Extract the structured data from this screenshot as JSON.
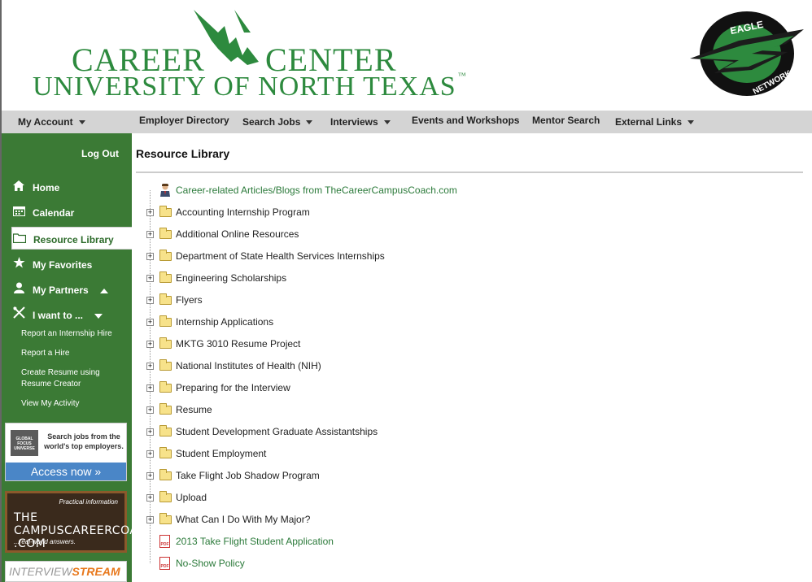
{
  "header": {
    "logo_career": "CAREER",
    "logo_center": "CENTER",
    "logo_university": "UNIVERSITY OF NORTH TEXAS",
    "logo_tm": "™",
    "eagle_top": "EAGLE",
    "eagle_bottom": "NETWORK"
  },
  "topnav": {
    "my_account": "My Account",
    "employer_directory": "Employer Directory",
    "search_jobs": "Search Jobs",
    "interviews": "Interviews",
    "events": "Events and Workshops",
    "mentor_search": "Mentor Search",
    "external_links": "External Links"
  },
  "sidebar": {
    "logout": "Log Out",
    "home": "Home",
    "calendar": "Calendar",
    "resource_library": "Resource Library",
    "my_favorites": "My Favorites",
    "my_partners": "My Partners",
    "i_want_to": "I want to ...",
    "sub_links": [
      "Report an Internship Hire",
      "Report a Hire",
      "Create Resume using Resume Creator",
      "View My Activity"
    ]
  },
  "ads": {
    "globalfocus_logo": "GLOBAL FOCUS UNIVERSE",
    "globalfocus_text": "Search jobs from the world's top employers.",
    "globalfocus_cta": "Access now »",
    "coach_small1": "Practical information",
    "coach_main": "THE CAMPUSCAREERCOACH .COM",
    "coach_small2": "...real-world answers.",
    "interview_a": "INTERVIEW",
    "interview_b": "STREAM"
  },
  "main": {
    "title": "Resource Library",
    "items": [
      {
        "label": "Career-related Articles/Blogs from TheCareerCampusCoach.com",
        "type": "person",
        "link": true
      },
      {
        "label": "Accounting Internship Program",
        "type": "folder"
      },
      {
        "label": "Additional Online Resources",
        "type": "folder"
      },
      {
        "label": "Department of State Health Services Internships",
        "type": "folder"
      },
      {
        "label": "Engineering Scholarships",
        "type": "folder"
      },
      {
        "label": "Flyers",
        "type": "folder"
      },
      {
        "label": "Internship Applications",
        "type": "folder"
      },
      {
        "label": "MKTG 3010 Resume Project",
        "type": "folder"
      },
      {
        "label": "National Institutes of Health (NIH)",
        "type": "folder"
      },
      {
        "label": "Preparing for the Interview",
        "type": "folder"
      },
      {
        "label": "Resume",
        "type": "folder"
      },
      {
        "label": "Student Development Graduate Assistantships",
        "type": "folder"
      },
      {
        "label": "Student Employment",
        "type": "folder"
      },
      {
        "label": "Take Flight Job Shadow Program",
        "type": "folder"
      },
      {
        "label": "Upload",
        "type": "folder"
      },
      {
        "label": "What Can I Do With My Major?",
        "type": "folder"
      },
      {
        "label": "2013 Take Flight Student Application",
        "type": "pdf",
        "link": true
      },
      {
        "label": "No-Show Policy",
        "type": "pdf",
        "link": true
      }
    ]
  },
  "colors": {
    "brand_green": "#3b7a35",
    "logo_green": "#2d8a3e",
    "link_green": "#2b7a3a",
    "nav_gray": "#d4d4d4",
    "cta_blue": "#4a86c7"
  }
}
